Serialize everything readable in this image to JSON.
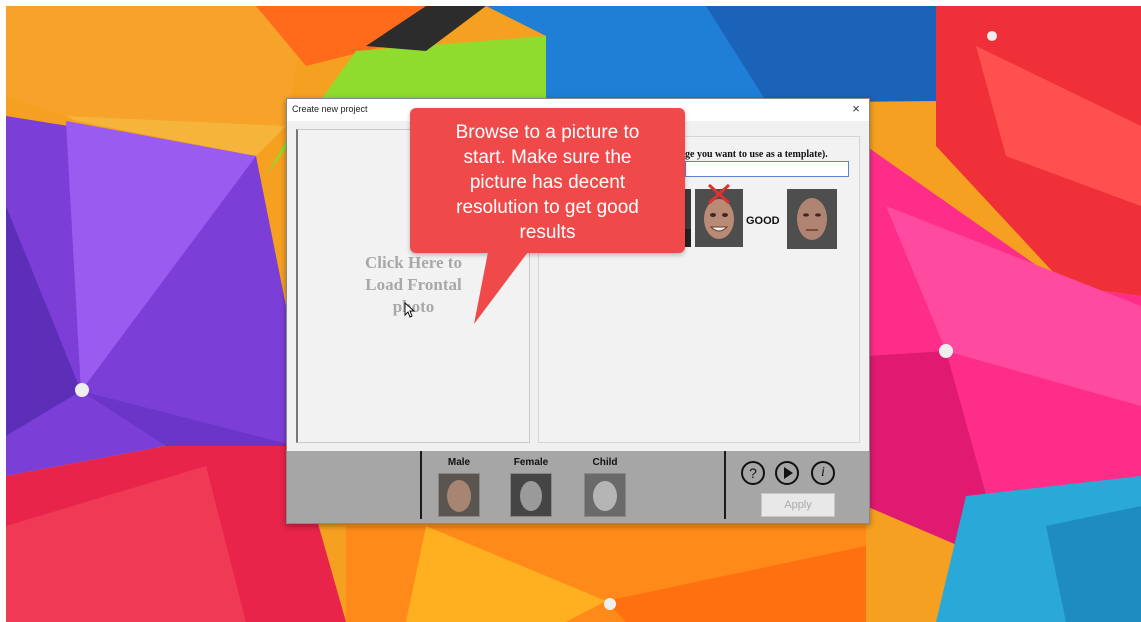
{
  "dialog": {
    "title": "Create new project",
    "close_glyph": "×"
  },
  "left_panel": {
    "load_line1": "Click Here to",
    "load_line2": "Load Frontal",
    "load_line3": "photo"
  },
  "right_panel": {
    "instruction": "ge you want to use as a template).",
    "path_value": "",
    "good_label": "GOOD"
  },
  "bottom_bar": {
    "genders": [
      {
        "label": "Male"
      },
      {
        "label": "Female"
      },
      {
        "label": "Child"
      }
    ],
    "help_icon": "help-icon",
    "play_icon": "play-icon",
    "info_icon": "info-icon",
    "apply_label": "Apply"
  },
  "callout": {
    "line1": "Browse to a picture to",
    "line2": "start. Make sure the",
    "line3": "picture has decent",
    "line4": "resolution to get good",
    "line5": "results"
  },
  "colors": {
    "callout": "#f0494a",
    "bottom_bar": "#a6a6a6",
    "input_border": "#5a86c8"
  }
}
